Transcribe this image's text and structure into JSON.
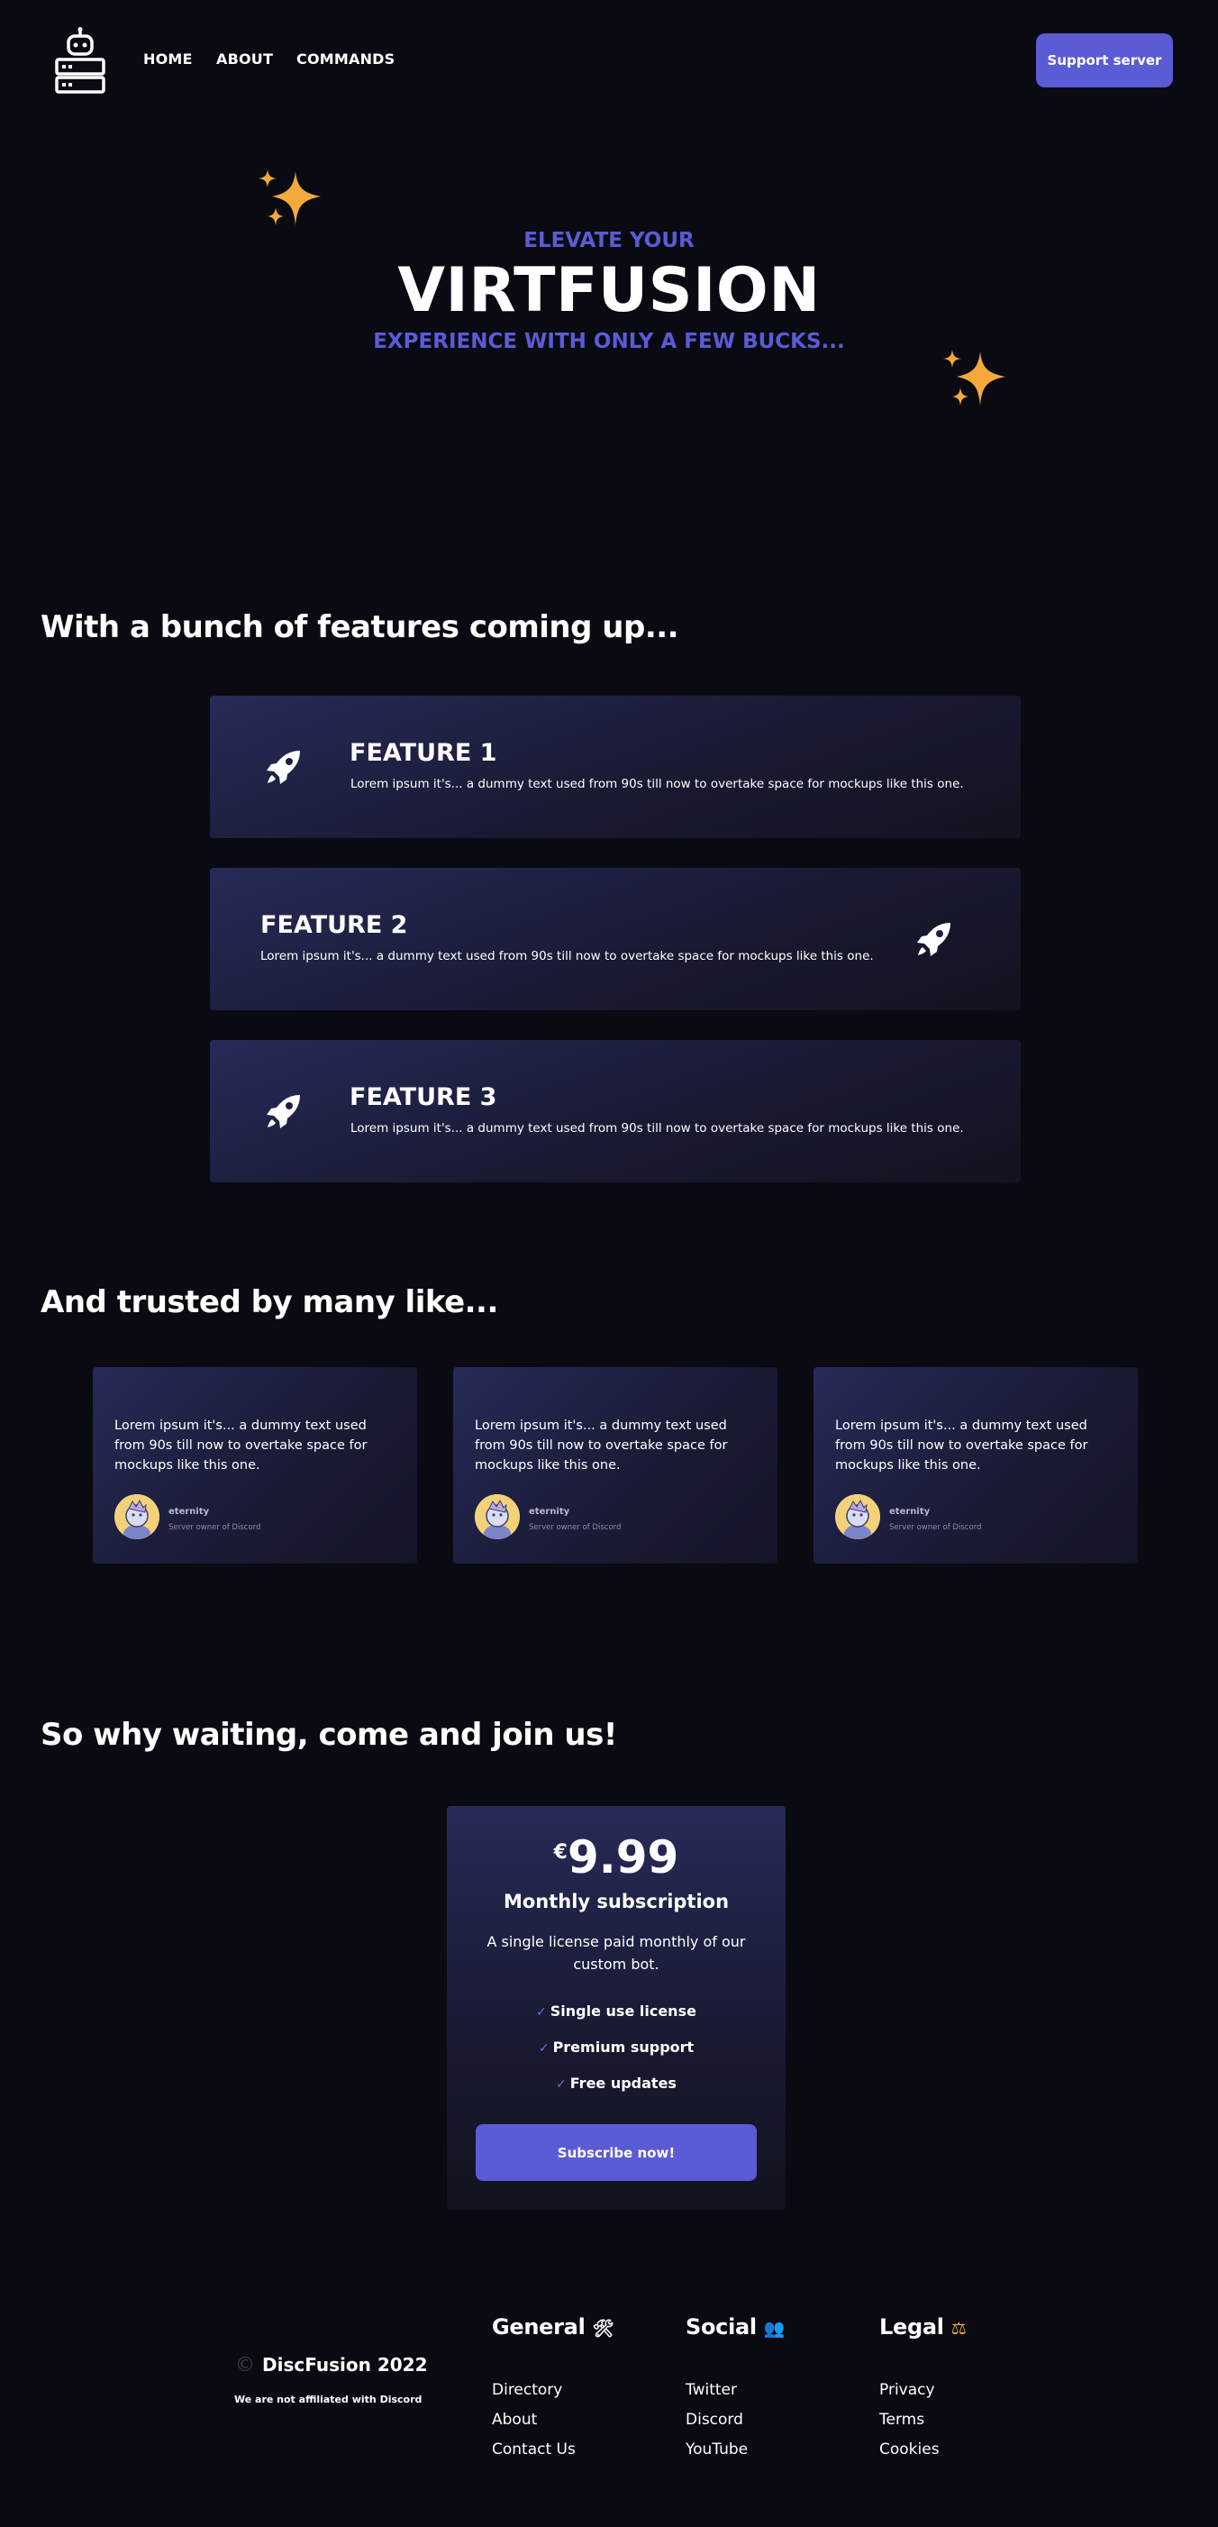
{
  "nav": {
    "links": [
      "HOME",
      "ABOUT",
      "COMMANDS"
    ],
    "support_label": "Support server"
  },
  "hero": {
    "line1": "ELEVATE YOUR",
    "title": "VIRTFUSION",
    "line2": "EXPERIENCE WITH ONLY A FEW BUCKS..."
  },
  "features": {
    "heading": "With a bunch of features coming up...",
    "items": [
      {
        "title": "FEATURE 1",
        "text": "Lorem ipsum it's... a dummy text used from 90s till now to overtake space for mockups like this one.",
        "icon": "rocket-icon"
      },
      {
        "title": "FEATURE 2",
        "text": "Lorem ipsum it's... a dummy text used from 90s till now to overtake space for mockups like this one.",
        "icon": "rocket-icon"
      },
      {
        "title": "FEATURE 3",
        "text": "Lorem ipsum it's... a dummy text used from 90s till now to overtake space for mockups like this one.",
        "icon": "rocket-icon"
      }
    ]
  },
  "testimonials": {
    "heading": "And trusted by many like...",
    "items": [
      {
        "text": "Lorem ipsum it's... a dummy text used from 90s till now to overtake space for mockups like this one.",
        "name": "eternity",
        "role": "Server owner of Discord"
      },
      {
        "text": "Lorem ipsum it's... a dummy text used from 90s till now to overtake space for mockups like this one.",
        "name": "eternity",
        "role": "Server owner of Discord"
      },
      {
        "text": "Lorem ipsum it's... a dummy text used from 90s till now to overtake space for mockups like this one.",
        "name": "eternity",
        "role": "Server owner of Discord"
      }
    ]
  },
  "pricing": {
    "heading": "So why waiting, come and join us!",
    "currency": "€",
    "price": "9.99",
    "plan": "Monthly subscription",
    "description": "A single license paid monthly of our custom bot.",
    "perks": [
      "Single use license",
      "Premium support",
      "Free updates"
    ],
    "cta": "Subscribe now!"
  },
  "footer": {
    "copyright": "DiscFusion 2022",
    "disclaimer": "We are not affiliated with Discord",
    "columns": [
      {
        "title": "General",
        "emoji": "🛠",
        "links": [
          "Directory",
          "About",
          "Contact Us"
        ]
      },
      {
        "title": "Social",
        "emoji": "👥",
        "links": [
          "Twitter",
          "Discord",
          "YouTube"
        ]
      },
      {
        "title": "Legal",
        "emoji": "⚖",
        "links": [
          "Privacy",
          "Terms",
          "Cookies"
        ]
      }
    ]
  },
  "colors": {
    "background": "#0a0b12",
    "accent": "#5b5bd6",
    "sparkle": "#f6a93b",
    "card_gradient_start": "#272a58"
  }
}
